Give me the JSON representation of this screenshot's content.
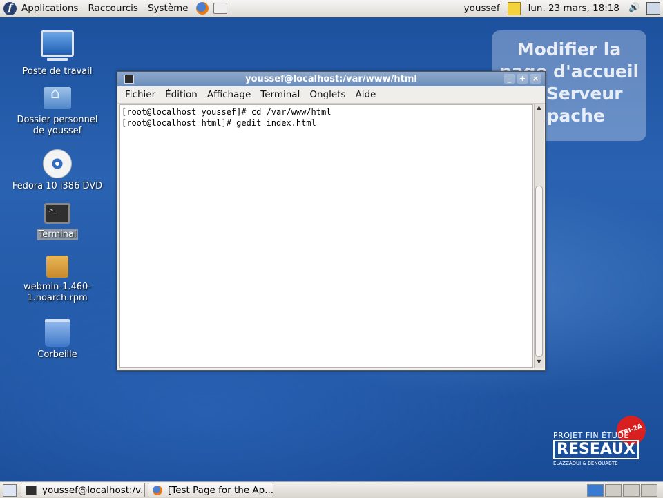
{
  "top_panel": {
    "menus": [
      "Applications",
      "Raccourcis",
      "Système"
    ],
    "user": "youssef",
    "clock": "lun. 23 mars, 18:18"
  },
  "desktop_icons": [
    {
      "label": "Poste de travail",
      "icon": "computer-icon"
    },
    {
      "label": "Dossier personnel de youssef",
      "icon": "home-folder-icon"
    },
    {
      "label": "Fedora 10 i386 DVD",
      "icon": "dvd-icon"
    },
    {
      "label": "Terminal",
      "icon": "terminal-icon"
    },
    {
      "label": "webmin-1.460-1.noarch.rpm",
      "icon": "package-icon"
    },
    {
      "label": "Corbeille",
      "icon": "trash-icon"
    }
  ],
  "terminal": {
    "title": "youssef@localhost:/var/www/html",
    "menu": [
      "Fichier",
      "Édition",
      "Affichage",
      "Terminal",
      "Onglets",
      "Aide"
    ],
    "lines": [
      "[root@localhost youssef]# cd /var/www/html",
      "[root@localhost html]# gedit index.html"
    ]
  },
  "overlay": {
    "text": "Modifier la page d'accueil du Serveur Apache"
  },
  "logo": {
    "line1": "PROJET FIN ÉTUDE",
    "line2": "RESEAUX",
    "line3": "ELAZZAOUI & BENOUABTE",
    "badge": "TRI-2A"
  },
  "taskbar": {
    "tasks": [
      "youssef@localhost:/v...",
      "[Test Page for the Ap..."
    ]
  }
}
